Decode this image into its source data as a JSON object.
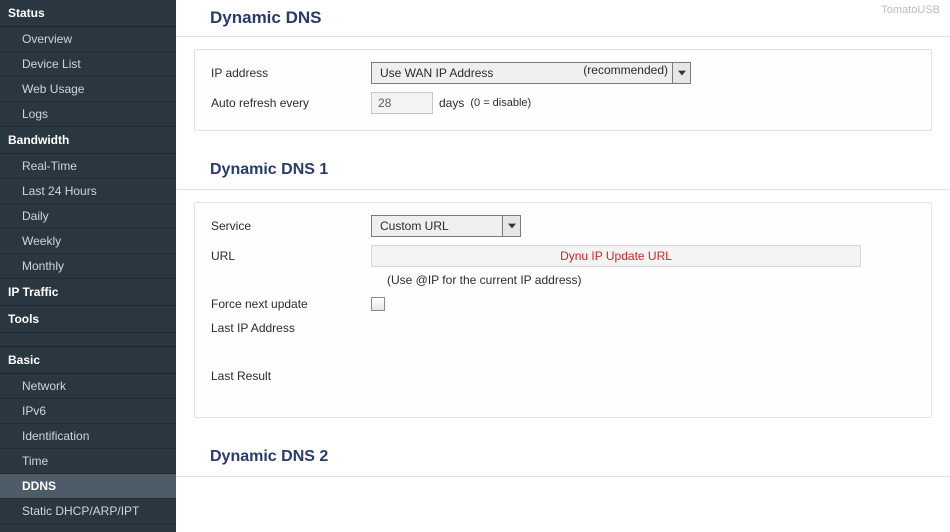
{
  "branding": "TomatoUSB",
  "sidebar": {
    "sections": [
      {
        "header": "Status",
        "items": [
          "Overview",
          "Device List",
          "Web Usage",
          "Logs"
        ]
      },
      {
        "header": "Bandwidth",
        "items": [
          "Real-Time",
          "Last 24 Hours",
          "Daily",
          "Weekly",
          "Monthly"
        ]
      },
      {
        "header": "IP Traffic",
        "items": []
      },
      {
        "header": "Tools",
        "items": []
      },
      {
        "header": "Basic",
        "items": [
          "Network",
          "IPv6",
          "Identification",
          "Time",
          "DDNS",
          "Static DHCP/ARP/IPT"
        ],
        "active": "DDNS"
      }
    ]
  },
  "page": {
    "title": "Dynamic DNS",
    "ip_address_label": "IP address",
    "ip_address_value": "Use WAN IP Address",
    "ip_address_recommended": "(recommended)",
    "auto_refresh_label": "Auto refresh every",
    "auto_refresh_value": "28",
    "auto_refresh_unit": "days",
    "auto_refresh_hint": "(0 = disable)"
  },
  "ddns1": {
    "title": "Dynamic DNS 1",
    "service_label": "Service",
    "service_value": "Custom URL",
    "url_label": "URL",
    "url_value": "Dynu IP Update URL",
    "url_hint": "(Use @IP for the current IP address)",
    "force_label": "Force next update",
    "force_checked": false,
    "last_ip_label": "Last IP Address",
    "last_ip_value": "",
    "last_result_label": "Last Result",
    "last_result_value": ""
  },
  "ddns2": {
    "title": "Dynamic DNS 2"
  }
}
